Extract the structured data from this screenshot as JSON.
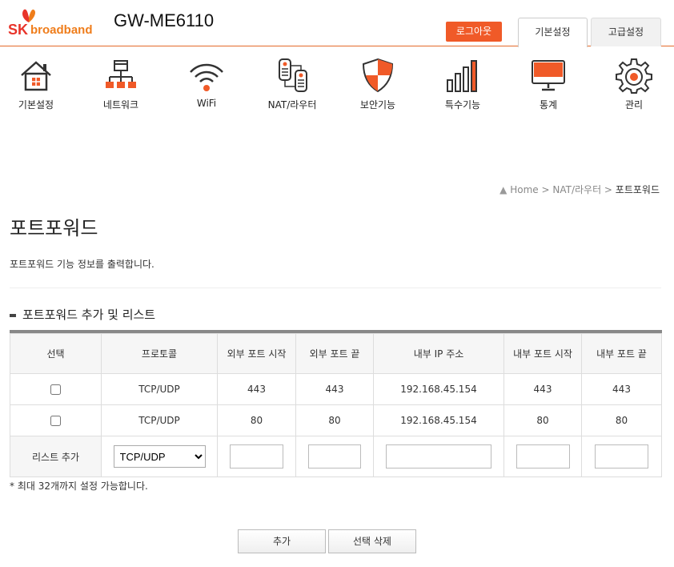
{
  "header": {
    "logo_sk": "SK",
    "logo_broadband": "broadband",
    "model": "GW-ME6110",
    "logout_label": "로그아웃",
    "tabs": [
      "기본설정",
      "고급설정"
    ]
  },
  "nav": {
    "items": [
      {
        "label": "기본설정",
        "icon": "home-icon"
      },
      {
        "label": "네트워크",
        "icon": "network-icon"
      },
      {
        "label": "WiFi",
        "icon": "wifi-icon"
      },
      {
        "label": "NAT/라우터",
        "icon": "router-icon"
      },
      {
        "label": "보안기능",
        "icon": "shield-icon"
      },
      {
        "label": "특수기능",
        "icon": "bar-chart-icon"
      },
      {
        "label": "통계",
        "icon": "monitor-icon"
      },
      {
        "label": "관리",
        "icon": "gear-icon"
      }
    ]
  },
  "breadcrumb": {
    "home": "Home",
    "sep": " > ",
    "section": "NAT/라우터",
    "current": "포트포워드"
  },
  "page": {
    "title": "포트포워드",
    "description": "포트포워드 기능 정보를 출력합니다.",
    "section_title": "포트포워드 추가 및 리스트"
  },
  "table": {
    "headers": [
      "선택",
      "프로토콜",
      "외부 포트 시작",
      "외부 포트 끝",
      "내부 IP 주소",
      "내부 포트 시작",
      "내부 포트 끝"
    ],
    "rows": [
      {
        "protocol": "TCP/UDP",
        "ext_start": "443",
        "ext_end": "443",
        "ip": "192.168.45.154",
        "int_start": "443",
        "int_end": "443"
      },
      {
        "protocol": "TCP/UDP",
        "ext_start": "80",
        "ext_end": "80",
        "ip": "192.168.45.154",
        "int_start": "80",
        "int_end": "80"
      }
    ],
    "add_row_label": "리스트 추가",
    "protocol_selected": "TCP/UDP"
  },
  "note": "* 최대 32개까지 설정 가능합니다.",
  "buttons": {
    "add": "추가",
    "delete_selected": "선택 삭제"
  },
  "colors": {
    "accent": "#f05a28",
    "brand_red": "#e8342a",
    "brand_orange": "#ef7d1b"
  }
}
